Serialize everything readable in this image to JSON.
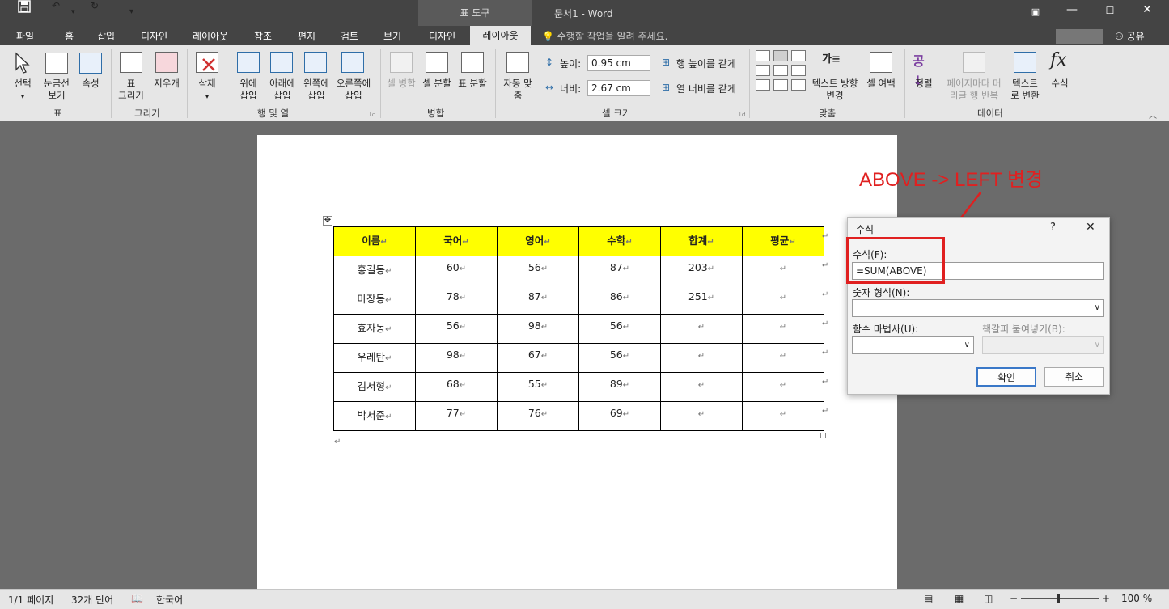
{
  "titlebar": {
    "tool_tab": "표 도구",
    "doc_title": "문서1 - Word",
    "undo_icon": "↶",
    "redo_icon": "↻",
    "save_icon": "💾"
  },
  "tabs": [
    "파일",
    "홈",
    "삽입",
    "디자인",
    "레이아웃",
    "참조",
    "편지",
    "검토",
    "보기",
    "디자인",
    "레이아웃"
  ],
  "tellme": "수행할 작업을 알려 주세요.",
  "share": "공유",
  "ribbon": {
    "select": "선택",
    "gridlines": "눈금선\n보기",
    "properties": "속성",
    "draw_table": "표\n그리기",
    "eraser": "지우개",
    "delete": "삭제",
    "insert_above": "위에\n삽입",
    "insert_below": "아래에\n삽입",
    "insert_left": "왼쪽에\n삽입",
    "insert_right": "오른쪽에\n삽입",
    "merge_cells": "셀 병합",
    "split_cells": "셀 분할",
    "split_table": "표 분할",
    "autofit": "자동 맞\n춤",
    "height_label": "높이:",
    "height_value": "0.95 cm",
    "width_label": "너비:",
    "width_value": "2.67 cm",
    "distribute_rows": "행 높이를 같게",
    "distribute_cols": "열 너비를 같게",
    "text_direction": "텍스트 방향\n변경",
    "cell_margins": "셀 여백",
    "sort": "정렬",
    "repeat_header": "페이지마다 머\n리글 행 반복",
    "convert_text": "텍스트\n로 변환",
    "formula": "수식",
    "groups": {
      "table": "표",
      "draw": "그리기",
      "rows_cols": "행 및 열",
      "merge": "병합",
      "cell_size": "셀 크기",
      "alignment": "맞춤",
      "data": "데이터"
    }
  },
  "table": {
    "headers": [
      "이름",
      "국어",
      "영어",
      "수학",
      "합계",
      "평균"
    ],
    "rows": [
      [
        "홍길동",
        "60",
        "56",
        "87",
        "203",
        ""
      ],
      [
        "마장동",
        "78",
        "87",
        "86",
        "251",
        ""
      ],
      [
        "효자동",
        "56",
        "98",
        "56",
        "",
        ""
      ],
      [
        "우레탄",
        "98",
        "67",
        "56",
        "",
        ""
      ],
      [
        "김서형",
        "68",
        "55",
        "89",
        "",
        ""
      ],
      [
        "박서준",
        "77",
        "76",
        "69",
        "",
        ""
      ]
    ],
    "mark": "↵"
  },
  "annotation": "ABOVE -> LEFT 변경",
  "dialog": {
    "title": "수식",
    "help": "?",
    "close": "✕",
    "formula_label": "수식(F):",
    "formula_value": "=SUM(ABOVE)",
    "number_format_label": "숫자 형식(N):",
    "number_format_value": "",
    "paste_function_label": "함수 마법사(U):",
    "paste_bookmark_label": "책갈피 붙여넣기(B):",
    "ok": "확인",
    "cancel": "취소"
  },
  "status": {
    "page": "1/1 페이지",
    "words": "32개 단어",
    "language": "한국어",
    "zoom": "100 %"
  },
  "colors": {
    "header_fill": "#ffff00",
    "annotation": "#e02020",
    "chrome_dark": "#444444"
  }
}
